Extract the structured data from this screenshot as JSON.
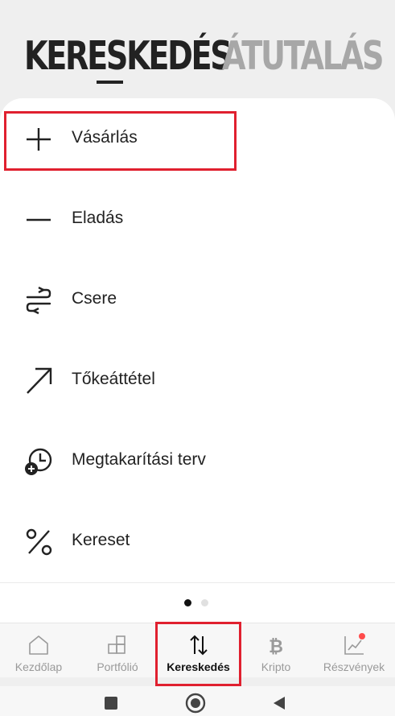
{
  "header": {
    "tabs": [
      {
        "label": "KERESKEDÉS",
        "active": true
      },
      {
        "label": "ÁTUTALÁS",
        "active": false
      }
    ]
  },
  "menu": [
    {
      "label": "Vásárlás",
      "icon": "plus-icon"
    },
    {
      "label": "Eladás",
      "icon": "minus-icon"
    },
    {
      "label": "Csere",
      "icon": "swap-icon"
    },
    {
      "label": "Tőkeáttétel",
      "icon": "arrow-up-right-icon"
    },
    {
      "label": "Megtakarítási terv",
      "icon": "clock-plus-icon"
    },
    {
      "label": "Kereset",
      "icon": "percent-icon"
    }
  ],
  "pager": {
    "current": 1,
    "total": 2
  },
  "bottom_nav": [
    {
      "label": "Kezdőlap",
      "icon": "home-icon",
      "active": false
    },
    {
      "label": "Portfólió",
      "icon": "portfolio-icon",
      "active": false
    },
    {
      "label": "Kereskedés",
      "icon": "trade-arrows-icon",
      "active": true
    },
    {
      "label": "Kripto",
      "icon": "bitcoin-icon",
      "active": false
    },
    {
      "label": "Részvények",
      "icon": "stocks-chart-icon",
      "active": false,
      "badge": true
    }
  ],
  "colors": {
    "highlight": "#e0202f",
    "background": "#efefef",
    "card": "#ffffff",
    "inactive_tab": "#a7a7a7",
    "badge": "#ff4b4b"
  }
}
